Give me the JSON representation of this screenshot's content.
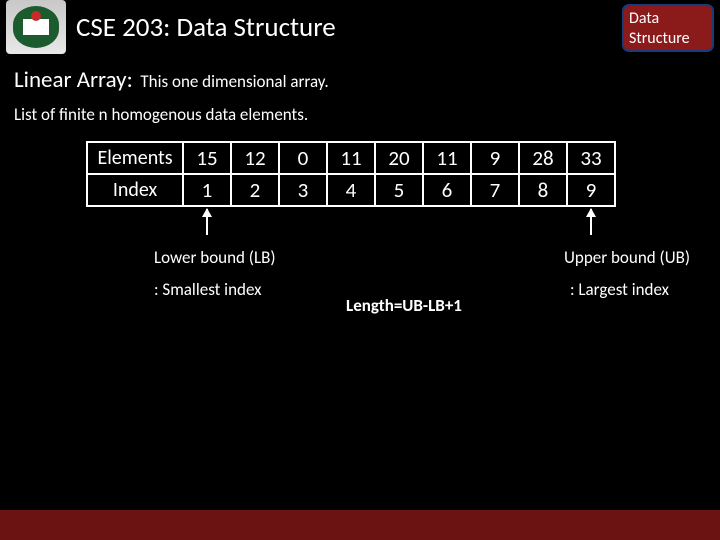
{
  "header": {
    "course_title": "CSE 203: Data Structure",
    "badge_line1": "Data",
    "badge_line2": "Structure"
  },
  "topic": {
    "label": "Linear Array:",
    "desc": "This one dimensional array.",
    "subdesc": "List of finite n homogenous data elements."
  },
  "array_table": {
    "row_labels": [
      "Elements",
      "Index"
    ],
    "elements": [
      "15",
      "12",
      "0",
      "11",
      "20",
      "11",
      "9",
      "28",
      "33"
    ],
    "indices": [
      "1",
      "2",
      "3",
      "4",
      "5",
      "6",
      "7",
      "8",
      "9"
    ]
  },
  "bounds": {
    "lb_label": "Lower bound (LB)",
    "ub_label": "Upper bound (UB)",
    "lb_desc": ": Smallest index",
    "ub_desc": ": Largest index",
    "length_formula": "Length=UB-LB+1"
  }
}
